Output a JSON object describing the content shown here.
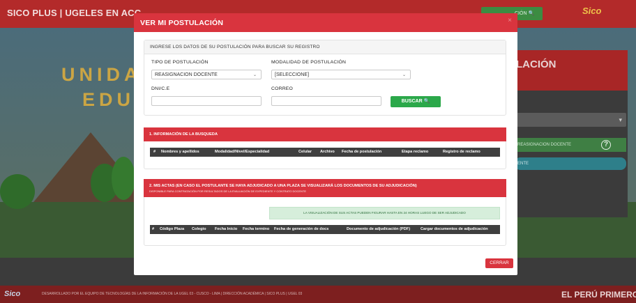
{
  "background": {
    "brand": "SICO PLUS | UGELES EN ACC",
    "header_button": "CIÓN 🔍",
    "header_logo": "Sico",
    "hero_word_1": "UNIDA",
    "hero_word_2": "EDUC",
    "side_title": "LACIÓN",
    "side_select_arrow": "▾",
    "side_green_text": "REASIGNACION DOCENTE",
    "side_help": "?",
    "side_teal_text": "ENTE",
    "footer_logo": "Sico",
    "footer_text": "DESARROLLADO POR EL EQUIPO DE TECNOLOGÍAS DE LA INFORMACIÓN DE LA UGEL 03 - CUSCO - LIMA | DIRECCIÓN ACADÉMICA | SICO PLUS | UGEL 03",
    "footer_right": "EL PERÚ PRIMERO"
  },
  "modal": {
    "title": "VER MI POSTULACIÓN",
    "close": "×",
    "search": {
      "heading": "INGRESE LOS DATOS DE SU POSTULACIÓN PARA BUSCAR SU REGISTRO",
      "tipo_label": "TIPO DE POSTULACIÓN",
      "tipo_value": "REASIGNACION DOCENTE",
      "modalidad_label": "MODALIDAD DE POSTULACIÓN",
      "modalidad_value": "[SELECCIONE]",
      "dni_label": "DNI/C.E",
      "dni_value": "",
      "correo_label": "CORREO",
      "correo_value": "",
      "buscar_label": "BUSCAR 🔍",
      "chevron": "⌄"
    },
    "info": {
      "heading": "1. INFORMACIÓN DE LA BUSQUEDA",
      "columns": [
        "#",
        "Nombres y apellidos",
        "Modalidad/Nivel/Especialidad",
        "Celular",
        "Archivo",
        "Fecha de postulación",
        "Etapa reclamo",
        "Registro de reclamo"
      ]
    },
    "actas": {
      "heading": "2. MIS ACTAS (EN CASO EL POSTULANTE SE HAYA ADJUDICADO A UNA PLAZA SE VISUALIZARÁ LOS DOCUMENTOS DE SU ADJUDICACIÓN)",
      "subheading": "DISPONIBLE PARA CONTRATACIÓN POR RESULTADOS DE LA EVALUACIÓN DE EXPEDIENTE Y CONTRATO DOCENTE",
      "alert": "LA VISUALIZACIÓN DE SUS ACTAS PUEDEN FIGURAR HASTA EN 24 HORAS LUEGO DE SER ADJUDICADO",
      "columns": [
        "#",
        "Código Plaza",
        "Colegio",
        "Fecha Inicio",
        "Fecha termino",
        "Fecha de generación de docs",
        "Documento de adjudicación (PDF)",
        "Cargar documentos de adjudicación"
      ]
    },
    "cerrar_label": "CERRAR"
  }
}
